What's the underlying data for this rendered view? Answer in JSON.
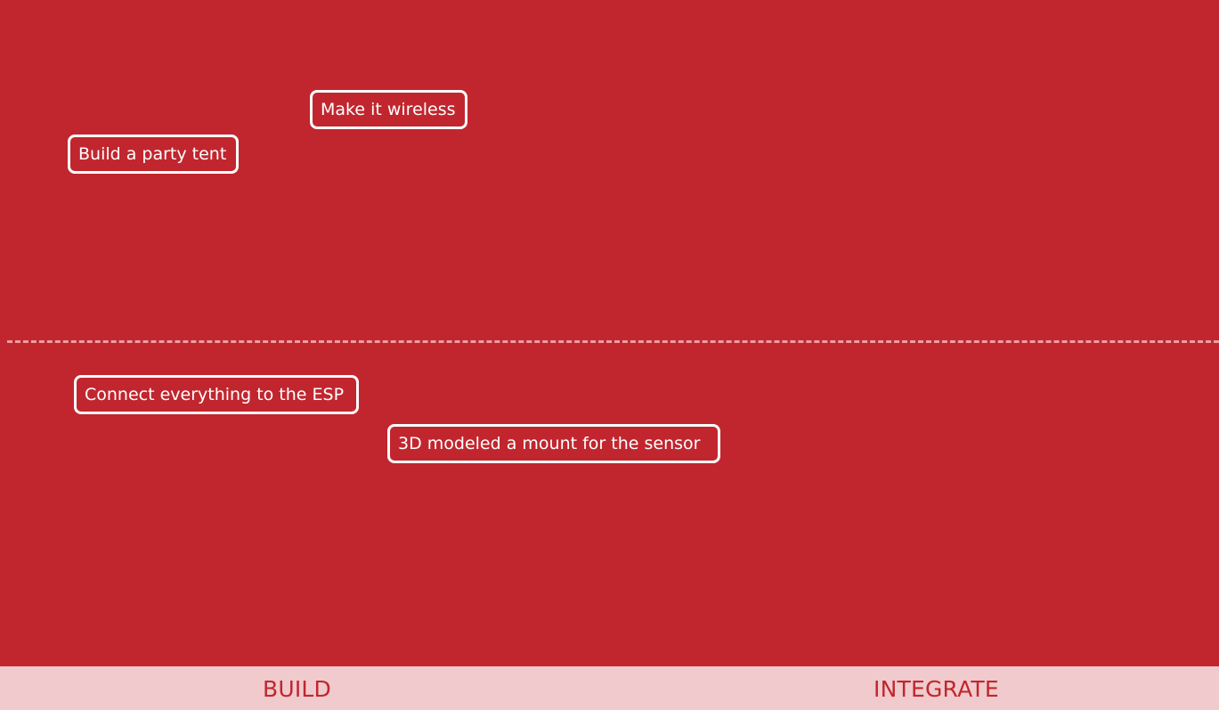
{
  "colors": {
    "board_background": "#c1262e",
    "divider": "#ec9da1",
    "note_border": "#ffffff",
    "note_text": "#ffffff",
    "footer_background": "#f0cacc",
    "footer_text": "#c1262e"
  },
  "notes": [
    {
      "text": "Make it wireless"
    },
    {
      "text": "Build a party tent"
    },
    {
      "text": "Connect everything to the ESP"
    },
    {
      "text": "3D modeled a mount for the sensor"
    }
  ],
  "footer": {
    "columns": [
      {
        "label": "BUILD"
      },
      {
        "label": "INTEGRATE"
      }
    ]
  }
}
